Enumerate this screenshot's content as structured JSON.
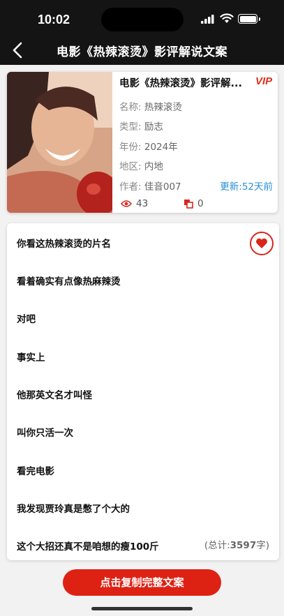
{
  "status_bar": {
    "time": "10:02"
  },
  "nav": {
    "title": "电影《热辣滚烫》影评解说文案"
  },
  "movie": {
    "title": "电影《热辣滚烫》影评解...",
    "vip": "VIP",
    "name_label": "名称:",
    "name": "热辣滚烫",
    "type_label": "类型:",
    "type": "励志",
    "year_label": "年份:",
    "year": "2024年",
    "region_label": "地区:",
    "region": "内地",
    "author_label": "作者:",
    "author": "佳音007",
    "updated": "更新:52天前",
    "views": "43",
    "copies": "0"
  },
  "script": {
    "lines": [
      "你看这热辣滚烫的片名",
      "看着确实有点像热麻辣烫",
      "对吧",
      "事实上",
      "他那英文名才叫怪",
      "叫你只活一次",
      "看完电影",
      "我发现贾玲真是憋了个大的",
      "这个大招还真不是咱想的瘦100斤"
    ],
    "total_prefix": "(总计:",
    "total_count": "3597",
    "total_suffix": "字)"
  },
  "actions": {
    "copy_button": "点击复制完整文案"
  },
  "colors": {
    "accent": "#dd2214",
    "link": "#2a8fd6",
    "topbar": "#141414"
  }
}
